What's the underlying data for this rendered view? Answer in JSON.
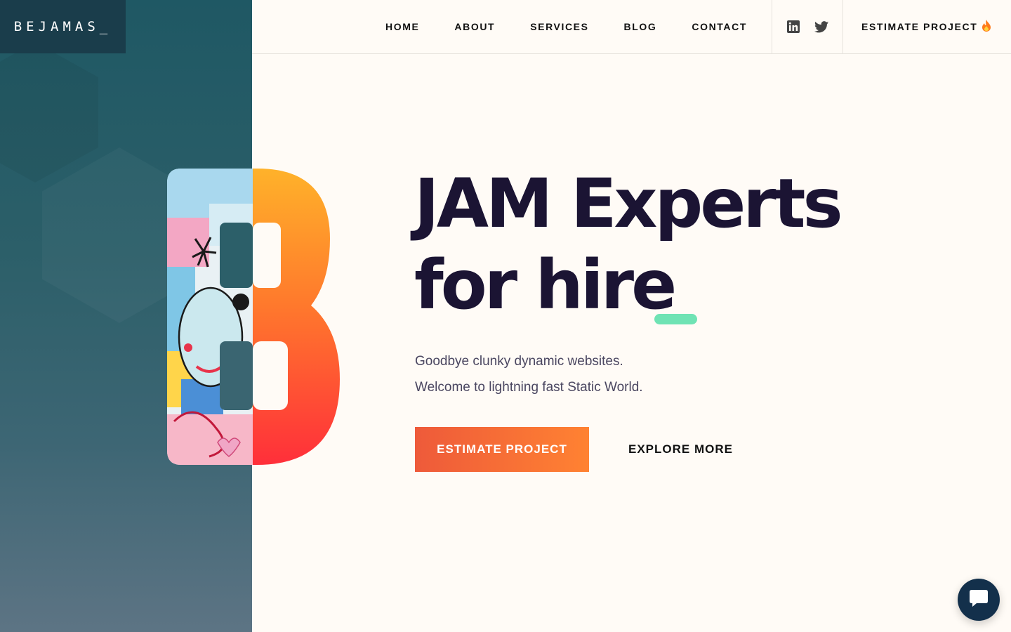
{
  "brand": {
    "logo_text": "BEJAMAS_"
  },
  "nav": {
    "items": [
      {
        "label": "HOME"
      },
      {
        "label": "ABOUT"
      },
      {
        "label": "SERVICES"
      },
      {
        "label": "BLOG"
      },
      {
        "label": "CONTACT"
      }
    ]
  },
  "social": {
    "icons": [
      "linkedin-icon",
      "twitter-icon"
    ]
  },
  "header_cta": {
    "label": "ESTIMATE PROJECT",
    "icon": "fire-icon"
  },
  "hero": {
    "title_line1": "JAM Experts",
    "title_line2": "for hire",
    "subtitle_line1": "Goodbye clunky dynamic websites.",
    "subtitle_line2": "Welcome to lightning fast Static World.",
    "primary_button": "ESTIMATE PROJECT",
    "secondary_button": "EXPLORE MORE"
  },
  "chat": {
    "icon": "chat-bubble-icon"
  },
  "colors": {
    "accent_gradient_start": "#ee5a3a",
    "accent_gradient_end": "#ff8232",
    "cursor_green": "#6fe3b4",
    "panel_teal": "#1f5864",
    "text_dark": "#1b1433",
    "background": "#fffbf6"
  }
}
